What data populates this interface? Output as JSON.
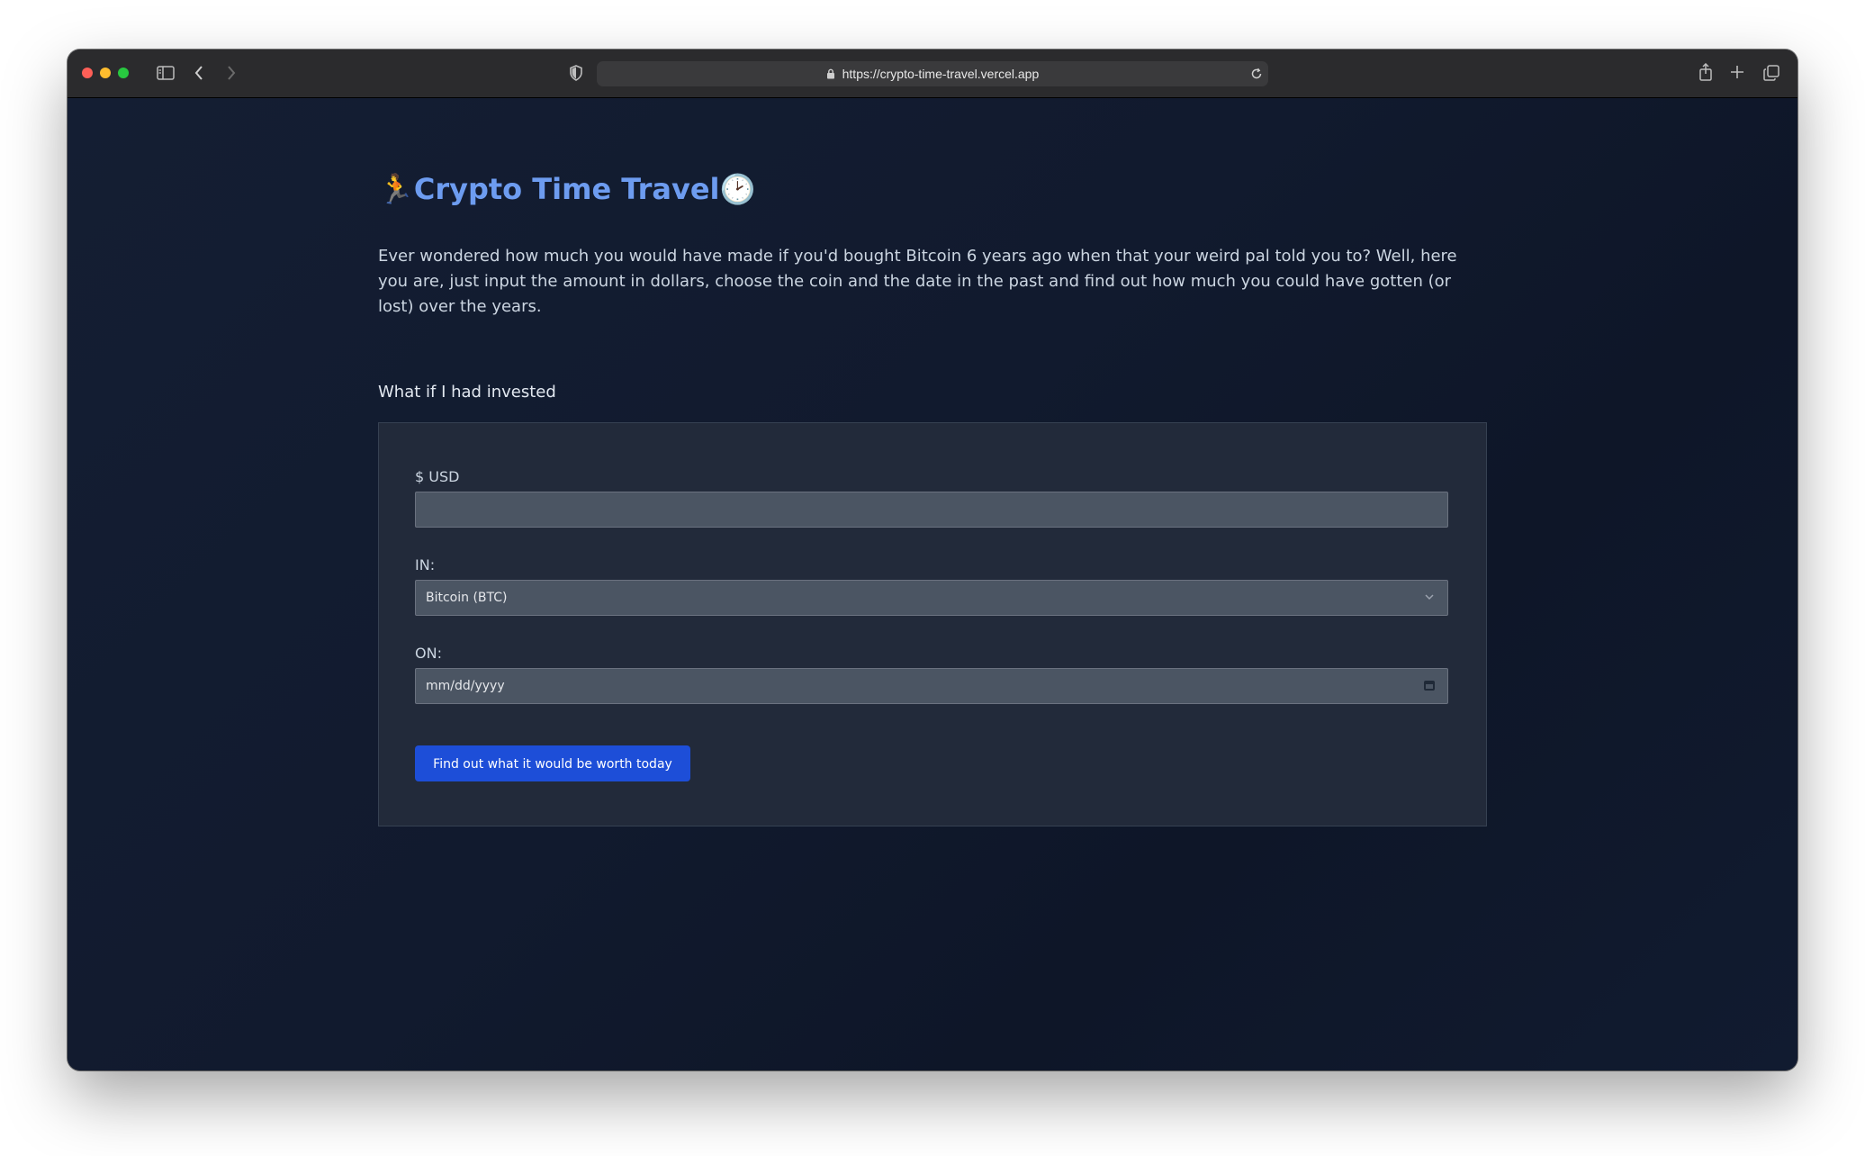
{
  "browser": {
    "url": "https://crypto-time-travel.vercel.app",
    "traffic_colors": [
      "#fe5f57",
      "#febc2e",
      "#28c840"
    ],
    "icons": [
      "sidebar-icon",
      "back-icon",
      "forward-icon",
      "shield-icon",
      "lock-icon",
      "reload-icon",
      "share-icon",
      "new-tab-icon",
      "tabs-overview-icon"
    ]
  },
  "page": {
    "title_emoji_left": "🏃",
    "title": "Crypto Time Travel",
    "title_emoji_right": "🕑",
    "intro": "Ever wondered how much you would have made if you'd bought Bitcoin 6 years ago when that your weird pal told you to? Well, here you are, just input the amount in dollars, choose the coin and the date in the past and find out how much you could have gotten (or lost) over the years.",
    "subheading": "What if I had invested"
  },
  "form": {
    "usd_label": "$ USD",
    "usd_value": "",
    "coin_label": "IN:",
    "coin_selected": "Bitcoin (BTC)",
    "date_label": "ON:",
    "date_placeholder": "mm/dd/yyyy",
    "submit_label": "Find out what it would be worth today"
  },
  "colors": {
    "accent": "#6d9cf0",
    "button": "#1d4ed8",
    "background": "#0f172a",
    "card": "#222a3a"
  }
}
